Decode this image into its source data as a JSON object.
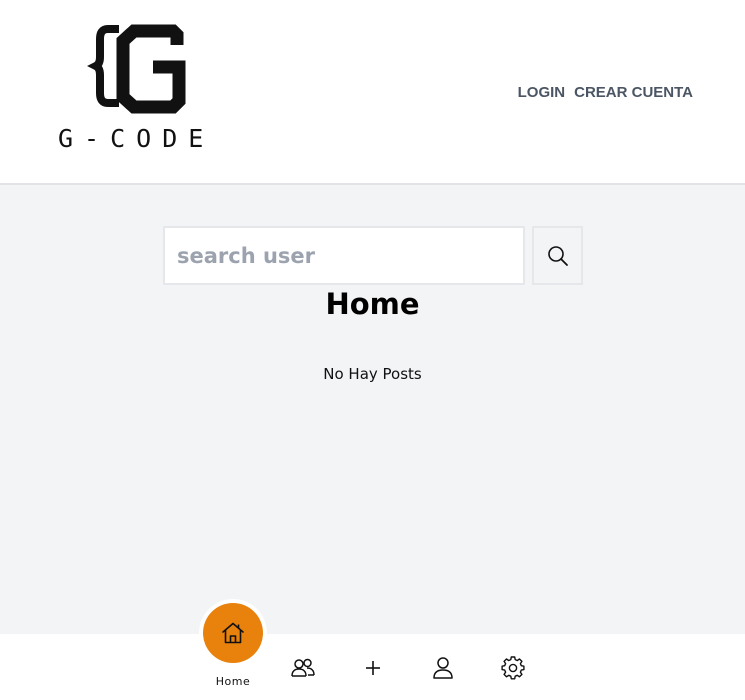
{
  "header": {
    "logo_wordmark": "G-CODE",
    "nav": {
      "login_label": "LOGIN",
      "register_label": "CREAR CUENTA"
    }
  },
  "search": {
    "placeholder": "search user",
    "value": ""
  },
  "main": {
    "title": "Home",
    "empty_message": "No Hay Posts"
  },
  "bottom_nav": {
    "items": [
      {
        "icon": "home-icon",
        "label": "Home",
        "active": true
      },
      {
        "icon": "users-icon"
      },
      {
        "icon": "plus-icon"
      },
      {
        "icon": "user-icon"
      },
      {
        "icon": "gear-icon"
      }
    ],
    "active_color": "#e8820c"
  },
  "colors": {
    "nav_text": "#4b5563",
    "background": "#f3f4f6",
    "accent": "#e8820c"
  }
}
